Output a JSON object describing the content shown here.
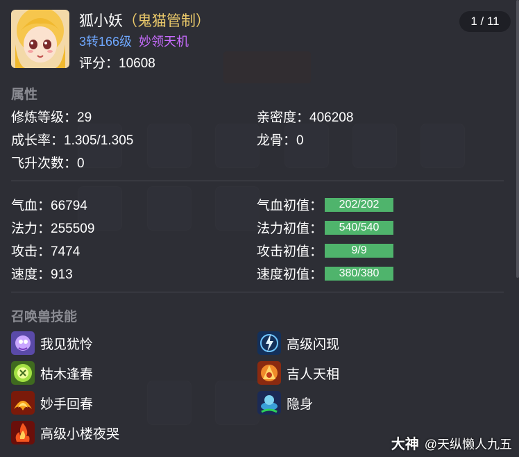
{
  "pet": {
    "name": "狐小妖",
    "title": "（鬼猫管制）",
    "level": "3转166级",
    "special_skill": "妙领天机",
    "score_label": "评分：",
    "score_value": "10608"
  },
  "pager": "1 / 11",
  "attributes": {
    "section_title": "属性",
    "cultivation": "修炼等级：29",
    "intimacy": "亲密度：406208",
    "growth": "成长率：1.305/1.305",
    "dragon_bone": "龙骨：0",
    "ascension": "飞升次数：0"
  },
  "stats": {
    "hp": "气血：66794",
    "hp_init_label": "气血初值：",
    "hp_init": "202/202",
    "mp": "法力：255509",
    "mp_init_label": "法力初值：",
    "mp_init": "540/540",
    "atk": "攻击：7474",
    "atk_init_label": "攻击初值：",
    "atk_init": "9/9",
    "spd": "速度：913",
    "spd_init_label": "速度初值：",
    "spd_init": "380/380"
  },
  "skills": {
    "section_title": "召唤兽技能",
    "items": [
      {
        "label": "我见犹怜",
        "icon": "pet-skill-icon"
      },
      {
        "label": "高级闪现",
        "icon": "lightning-skill-icon"
      },
      {
        "label": "枯木逢春",
        "icon": "revive-skill-icon"
      },
      {
        "label": "吉人天相",
        "icon": "fortune-skill-icon"
      },
      {
        "label": "妙手回春",
        "icon": "phoenix-skill-icon"
      },
      {
        "label": "隐身",
        "icon": "stealth-skill-icon"
      },
      {
        "label": "高级小楼夜哭",
        "icon": "fire-skill-icon"
      }
    ]
  },
  "watermark": {
    "brand": "大神",
    "user": "@天纵懒人九五"
  },
  "colors": {
    "title": "#e9c86a",
    "level": "#6fa8ff",
    "special_skill": "#c86cff",
    "bar": "#4fb46c"
  }
}
